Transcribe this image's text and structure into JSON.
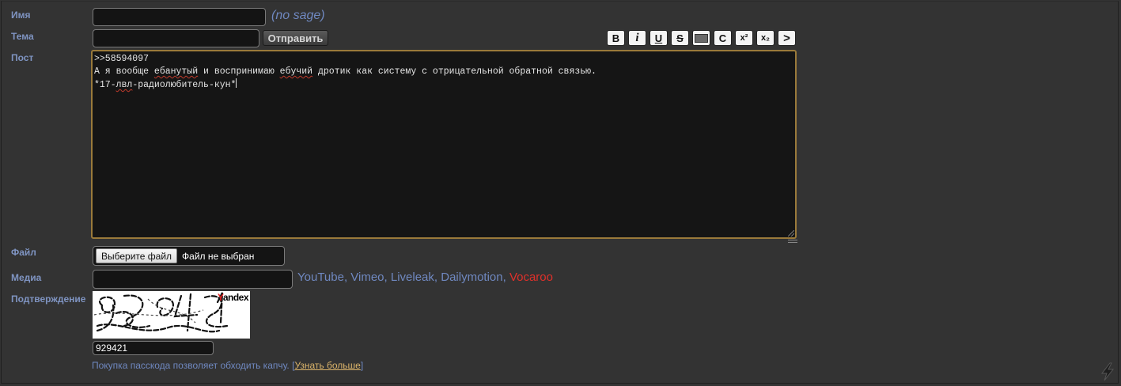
{
  "labels": {
    "name": "Имя",
    "subject": "Тема",
    "post": "Пост",
    "file": "Файл",
    "media": "Медиа",
    "captcha": "Подтверждение"
  },
  "name_field": {
    "value": "",
    "hint": "(no sage)"
  },
  "subject_field": {
    "value": ""
  },
  "send_button": "Отправить",
  "toolbar": [
    {
      "name": "bold-button",
      "glyph": "B"
    },
    {
      "name": "italic-button",
      "glyph": "i"
    },
    {
      "name": "underline-button",
      "glyph": "U"
    },
    {
      "name": "strike-button",
      "glyph": "S"
    },
    {
      "name": "spoiler-button",
      "glyph": ""
    },
    {
      "name": "code-button",
      "glyph": "C"
    },
    {
      "name": "superscript-button",
      "glyph": "x²"
    },
    {
      "name": "subscript-button",
      "glyph": "x₂"
    },
    {
      "name": "quote-button",
      "glyph": ">"
    }
  ],
  "post_text": {
    "line1": ">>58594097",
    "line2_parts": [
      "А я вообще ",
      "ебанутый",
      " и воспринимаю ",
      "ебучий",
      " дротик как систему с отрицательной обратной связью."
    ],
    "line3_parts": [
      "*17-",
      "лвл",
      "-радиолюбитель-кун*"
    ]
  },
  "file_input": {
    "button": "Выберите файл",
    "status": "Файл не выбран"
  },
  "media_field": {
    "value": ""
  },
  "media_links": {
    "services": "YouTube, Vimeo, Liveleak, Dailymotion,",
    "vocaroo": "Vocaroo"
  },
  "captcha": {
    "image_text": "929421",
    "brand_y": "Y",
    "brand_rest": "andex",
    "input_value": "929421"
  },
  "passcode_note": {
    "text": "Покупка пасскода позволяет обходить капчу. [",
    "link": "Узнать больше",
    "close": "]"
  },
  "colors": {
    "background": "#333333",
    "label": "#7f94c2",
    "link": "#6f88c0",
    "vocaroo": "#e0302a",
    "post_border": "#9a7a3a"
  }
}
